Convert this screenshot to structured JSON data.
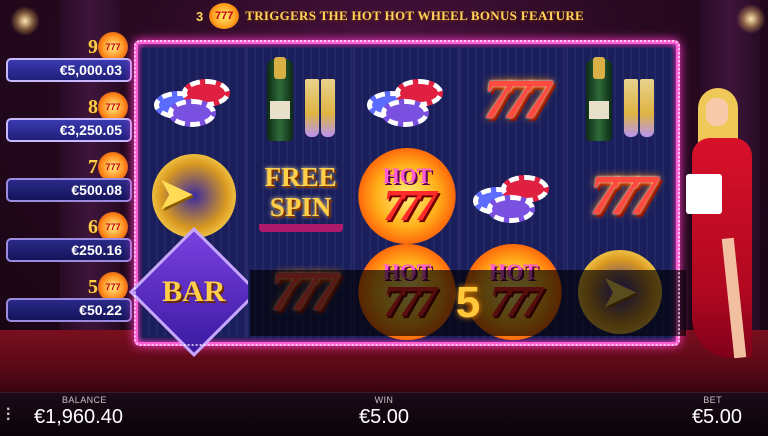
{
  "banner": {
    "count": "3",
    "logo_text": "777",
    "text": "TRIGGERS THE HOT HOT WHEEL BONUS FEATURE"
  },
  "jackpots": [
    {
      "level": "9",
      "amount": "€5,000.03"
    },
    {
      "level": "8",
      "amount": "€3,250.05"
    },
    {
      "level": "7",
      "amount": "€500.08"
    },
    {
      "level": "6",
      "amount": "€250.16"
    },
    {
      "level": "5",
      "amount": "€50.22"
    }
  ],
  "reels": {
    "symbols": [
      [
        "chips",
        "arrows-777",
        "bar"
      ],
      [
        "champagne",
        "free-spin",
        "777"
      ],
      [
        "chips",
        "hot-777",
        "hot-777"
      ],
      [
        "777",
        "chips",
        "hot-777"
      ],
      [
        "champagne",
        "777",
        "arrows-777"
      ]
    ],
    "free_spin_line1": "FREE",
    "free_spin_line2": "SPIN",
    "bar_label": "BAR",
    "hot_label": "HOT",
    "seven_label": "777",
    "win_count": "5"
  },
  "footer": {
    "balance_label": "BALANCE",
    "balance_value": "€1,960.40",
    "win_label": "WIN",
    "win_value": "€5.00",
    "bet_label": "BET",
    "bet_value": "€5.00"
  },
  "colors": {
    "frame": "#ff5fd0",
    "gold": "#ffcf4a",
    "jackpot_box": "#2a2a88"
  }
}
